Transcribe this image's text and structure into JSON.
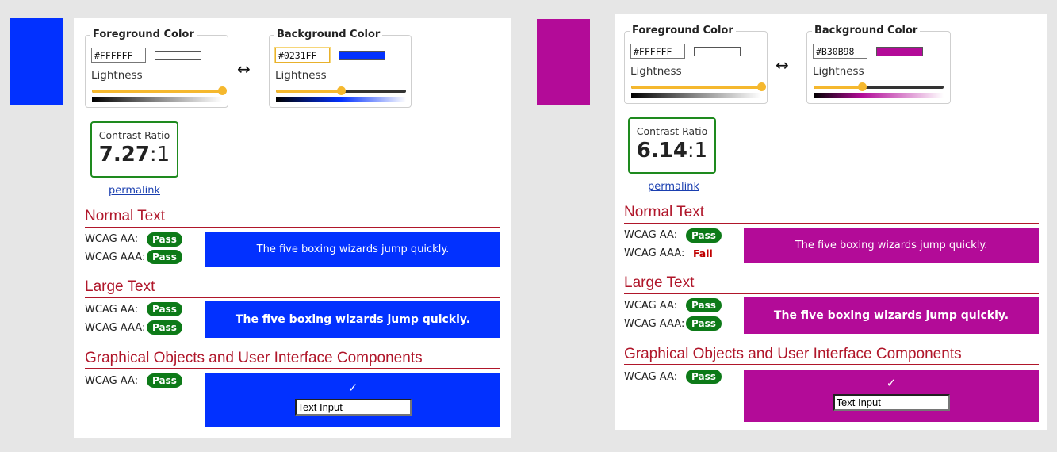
{
  "colors": {
    "pass_green": "#0d7a18",
    "heading_red": "#b0162a",
    "slider_yellow": "#f5b82e"
  },
  "panels": [
    {
      "swatch_color": "#0231FF",
      "foreground": {
        "legend": "Foreground Color",
        "hex": "#FFFFFF",
        "chip_color": "#FFFFFF",
        "lightness_label": "Lightness",
        "lightness_percent": 100
      },
      "swap_icon": "↔",
      "background": {
        "legend": "Background Color",
        "hex": "#0231FF",
        "chip_color": "#0231FF",
        "lightness_label": "Lightness",
        "lightness_percent": 50
      },
      "contrast": {
        "label": "Contrast Ratio",
        "value": "7.27",
        "suffix": ":1"
      },
      "permalink": "permalink",
      "normal_text": {
        "title": "Normal Text",
        "aa_label": "WCAG AA:",
        "aa_result": "Pass",
        "aaa_label": "WCAG AAA:",
        "aaa_result": "Pass",
        "sample": "The five boxing wizards jump quickly."
      },
      "large_text": {
        "title": "Large Text",
        "aa_label": "WCAG AA:",
        "aa_result": "Pass",
        "aaa_label": "WCAG AAA:",
        "aaa_result": "Pass",
        "sample": "The five boxing wizards jump quickly."
      },
      "graphical": {
        "title": "Graphical Objects and User Interface Components",
        "aa_label": "WCAG AA:",
        "aa_result": "Pass",
        "check_icon": "✓",
        "input_value": "Text Input"
      }
    },
    {
      "swatch_color": "#B30B98",
      "foreground": {
        "legend": "Foreground Color",
        "hex": "#FFFFFF",
        "chip_color": "#FFFFFF",
        "lightness_label": "Lightness",
        "lightness_percent": 100
      },
      "swap_icon": "↔",
      "background": {
        "legend": "Background Color",
        "hex": "#B30B98",
        "chip_color": "#B30B98",
        "lightness_label": "Lightness",
        "lightness_percent": 37
      },
      "contrast": {
        "label": "Contrast Ratio",
        "value": "6.14",
        "suffix": ":1"
      },
      "permalink": "permalink",
      "normal_text": {
        "title": "Normal Text",
        "aa_label": "WCAG AA:",
        "aa_result": "Pass",
        "aaa_label": "WCAG AAA:",
        "aaa_result": "Fail",
        "sample": "The five boxing wizards jump quickly."
      },
      "large_text": {
        "title": "Large Text",
        "aa_label": "WCAG AA:",
        "aa_result": "Pass",
        "aaa_label": "WCAG AAA:",
        "aaa_result": "Pass",
        "sample": "The five boxing wizards jump quickly."
      },
      "graphical": {
        "title": "Graphical Objects and User Interface Components",
        "aa_label": "WCAG AA:",
        "aa_result": "Pass",
        "check_icon": "✓",
        "input_value": "Text Input"
      }
    }
  ]
}
